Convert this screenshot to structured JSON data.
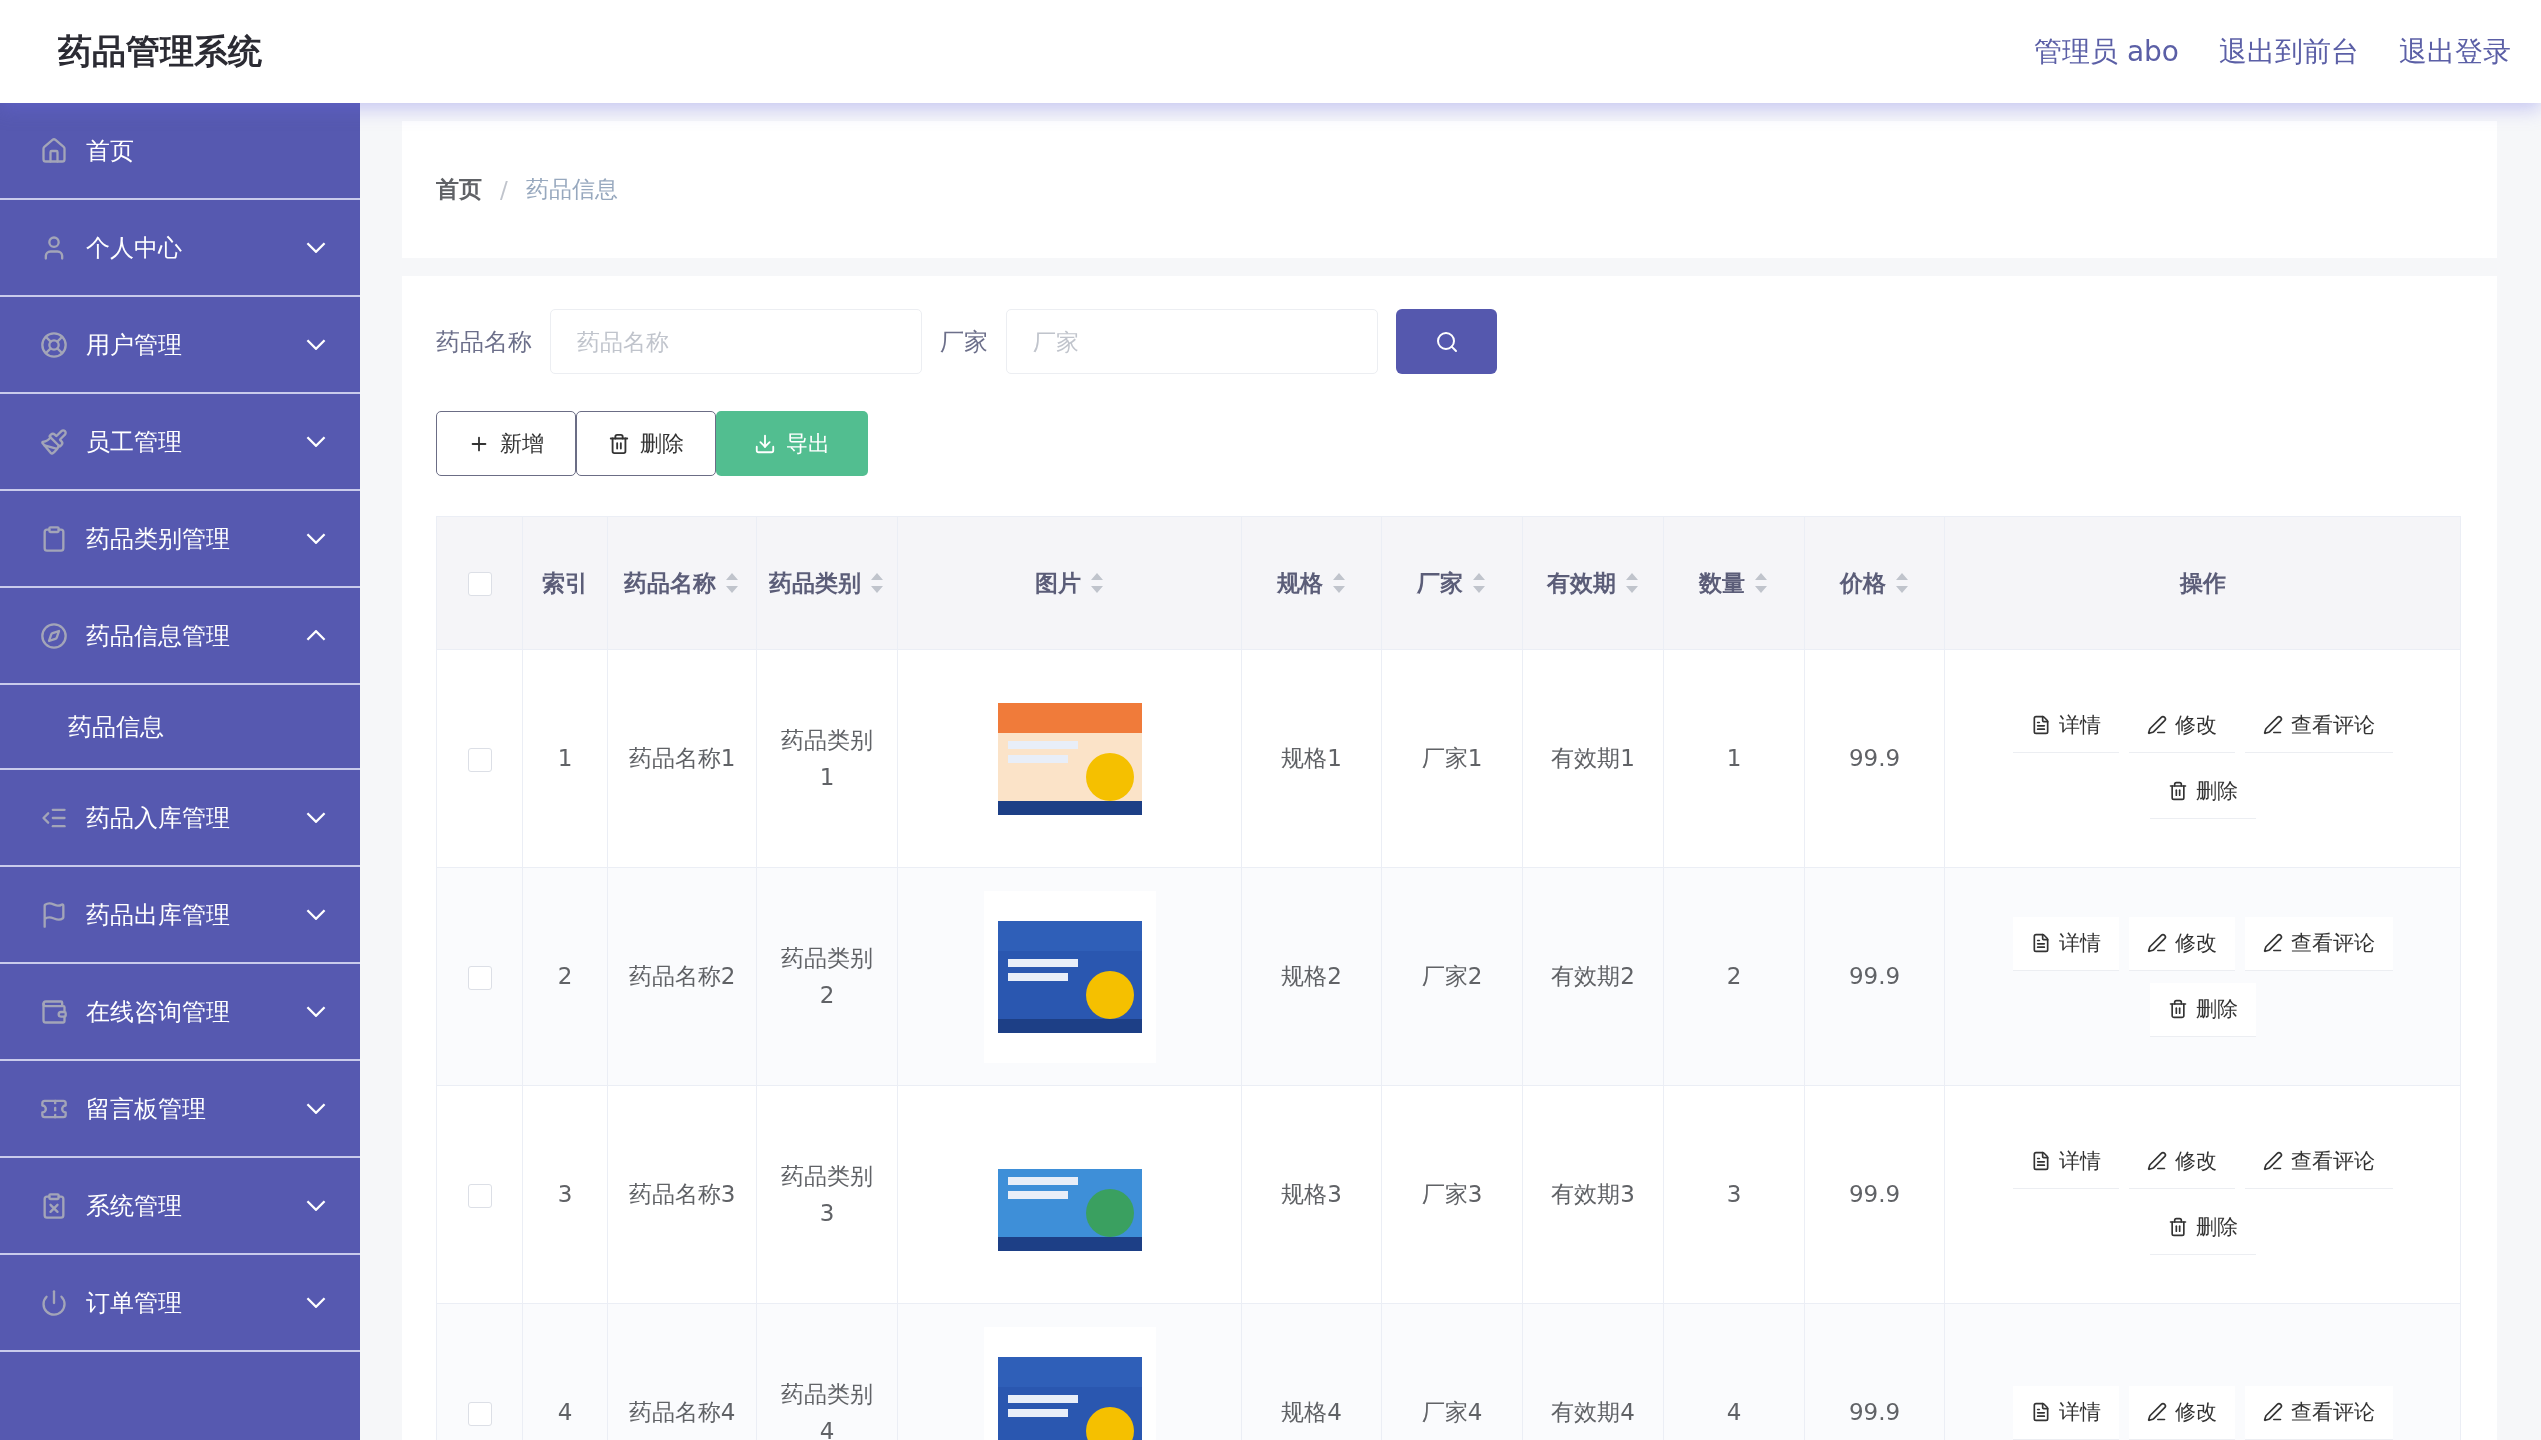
{
  "header": {
    "title": "药品管理系统",
    "links": [
      "管理员 abo",
      "退出到前台",
      "退出登录"
    ]
  },
  "sidebar": {
    "items": [
      {
        "label": "首页"
      },
      {
        "label": "个人中心",
        "expanded": false
      },
      {
        "label": "用户管理",
        "expanded": false
      },
      {
        "label": "员工管理",
        "expanded": false
      },
      {
        "label": "药品类别管理",
        "expanded": false
      },
      {
        "label": "药品信息管理",
        "expanded": true,
        "children": [
          {
            "label": "药品信息"
          }
        ]
      },
      {
        "label": "药品入库管理",
        "expanded": false
      },
      {
        "label": "药品出库管理",
        "expanded": false
      },
      {
        "label": "在线咨询管理",
        "expanded": false
      },
      {
        "label": "留言板管理",
        "expanded": false
      },
      {
        "label": "系统管理",
        "expanded": false
      },
      {
        "label": "订单管理",
        "expanded": false
      }
    ]
  },
  "breadcrumb": {
    "items": [
      "首页",
      "药品信息"
    ],
    "separator": "/"
  },
  "search": {
    "fields": [
      {
        "label": "药品名称",
        "placeholder": "药品名称"
      },
      {
        "label": "厂家",
        "placeholder": "厂家"
      }
    ]
  },
  "toolbar": [
    {
      "label": "新增",
      "kind": "add"
    },
    {
      "label": "删除",
      "kind": "delete"
    },
    {
      "label": "导出",
      "kind": "export"
    }
  ],
  "table": {
    "select_all": {
      "checked": false
    },
    "columns": [
      {
        "label": "索引",
        "sortable": false
      },
      {
        "label": "药品名称",
        "sortable": true
      },
      {
        "label": "药品类别",
        "sortable": true
      },
      {
        "label": "图片",
        "sortable": true
      },
      {
        "label": "规格",
        "sortable": true
      },
      {
        "label": "厂家",
        "sortable": true
      },
      {
        "label": "有效期",
        "sortable": true
      },
      {
        "label": "数量",
        "sortable": true
      },
      {
        "label": "价格",
        "sortable": true
      },
      {
        "label": "操作",
        "sortable": false
      }
    ],
    "rows": [
      {
        "checked": false,
        "cells": [
          "1",
          "药品名称1",
          "药品类别\n1",
          {
            "kind": "picture"
          },
          "规格1",
          "厂家1",
          "有效期1",
          "1",
          "99.9"
        ],
        "actions": [
          {
            "label": "详情",
            "kind": "detail"
          },
          {
            "label": "修改",
            "kind": "edit"
          },
          {
            "label": "查看评论",
            "kind": "edit"
          },
          {
            "label": "删除",
            "kind": "delete"
          }
        ]
      },
      {
        "checked": false,
        "cells": [
          "2",
          "药品名称2",
          "药品类别\n2",
          {
            "kind": "picture"
          },
          "规格2",
          "厂家2",
          "有效期2",
          "2",
          "99.9"
        ],
        "actions": [
          {
            "label": "详情",
            "kind": "detail"
          },
          {
            "label": "修改",
            "kind": "edit"
          },
          {
            "label": "查看评论",
            "kind": "edit"
          },
          {
            "label": "删除",
            "kind": "delete"
          }
        ]
      },
      {
        "checked": false,
        "cells": [
          "3",
          "药品名称3",
          "药品类别\n3",
          {
            "kind": "picture"
          },
          "规格3",
          "厂家3",
          "有效期3",
          "3",
          "99.9"
        ],
        "actions": [
          {
            "label": "详情",
            "kind": "detail"
          },
          {
            "label": "修改",
            "kind": "edit"
          },
          {
            "label": "查看评论",
            "kind": "edit"
          },
          {
            "label": "删除",
            "kind": "delete"
          }
        ]
      },
      {
        "checked": false,
        "cells": [
          "4",
          "药品名称4",
          "药品类别\n4",
          {
            "kind": "picture"
          },
          "规格4",
          "厂家4",
          "有效期4",
          "4",
          "99.9"
        ],
        "actions": [
          {
            "label": "详情",
            "kind": "detail"
          },
          {
            "label": "修改",
            "kind": "edit"
          },
          {
            "label": "查看评论",
            "kind": "edit"
          }
        ]
      }
    ]
  }
}
